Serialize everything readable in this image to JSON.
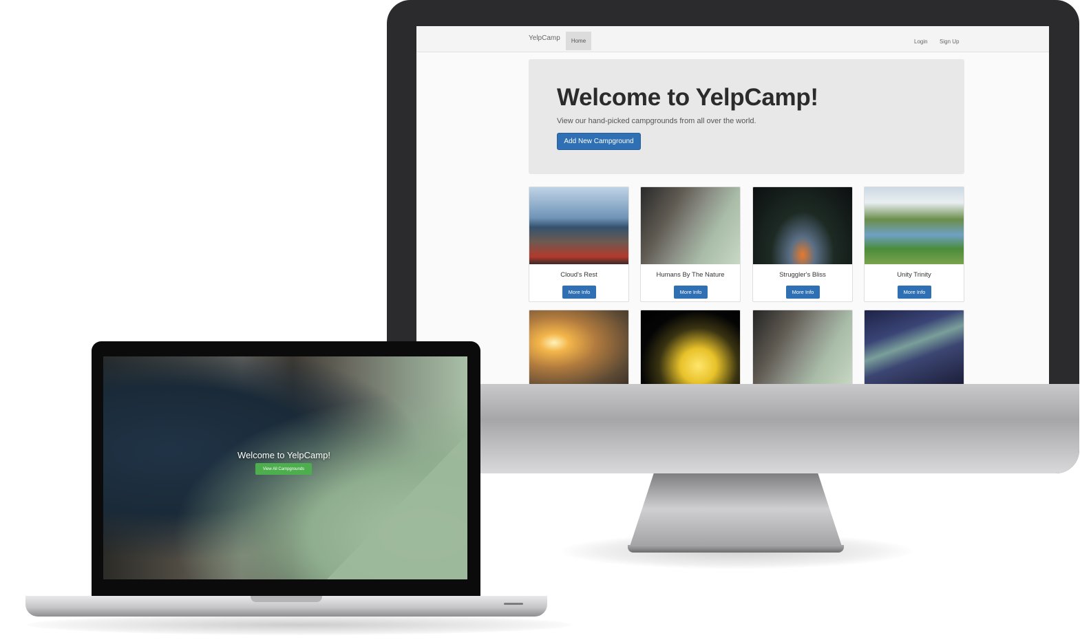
{
  "desktop": {
    "navbar": {
      "brand": "YelpCamp",
      "home": "Home",
      "login": "Login",
      "signup": "Sign Up"
    },
    "jumbotron": {
      "title": "Welcome to YelpCamp!",
      "subtitle": "View our hand-picked campgrounds from all over the world.",
      "button": "Add New Campground"
    },
    "campgrounds": [
      {
        "name": "Cloud's Rest",
        "button": "More Info"
      },
      {
        "name": "Humans By The Nature",
        "button": "More Info"
      },
      {
        "name": "Struggler's Bliss",
        "button": "More Info"
      },
      {
        "name": "Unity Trinity",
        "button": "More Info"
      }
    ]
  },
  "laptop": {
    "title": "Welcome to YelpCamp!",
    "button": "View All Campgrounds"
  },
  "colors": {
    "primary_button": "#2f6fb3",
    "success_button": "#4cae4c",
    "jumbotron_bg": "#e8e8e8",
    "navbar_bg": "#f4f4f4"
  }
}
